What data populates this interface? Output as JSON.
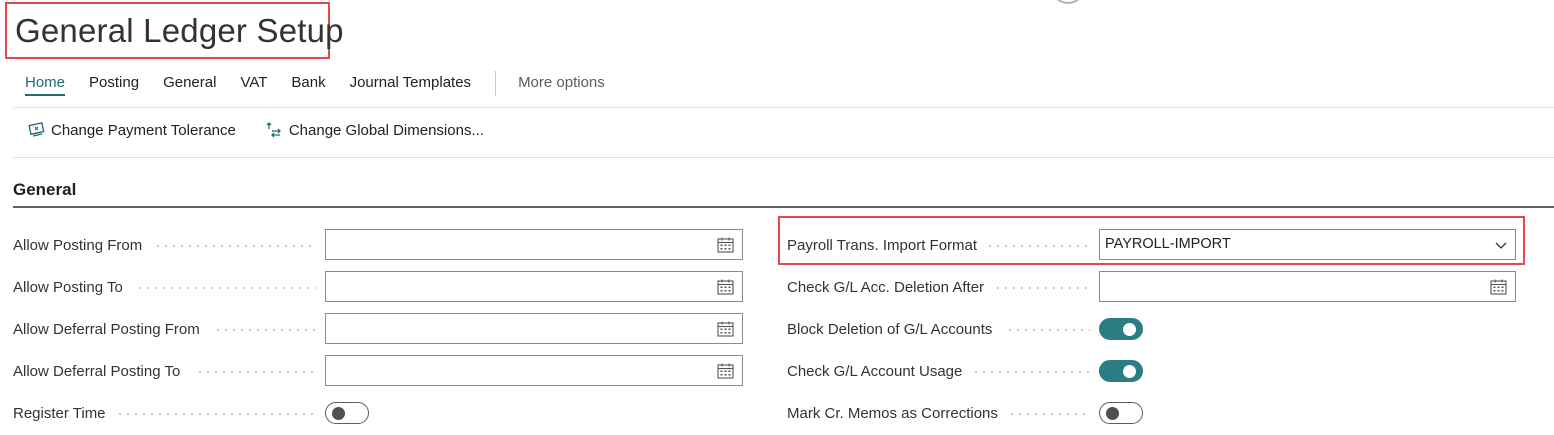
{
  "page": {
    "title": "General Ledger Setup"
  },
  "nav": {
    "tabs": [
      {
        "label": "Home",
        "active": true
      },
      {
        "label": "Posting",
        "active": false
      },
      {
        "label": "General",
        "active": false
      },
      {
        "label": "VAT",
        "active": false
      },
      {
        "label": "Bank",
        "active": false
      },
      {
        "label": "Journal Templates",
        "active": false
      }
    ],
    "more_label": "More options"
  },
  "actions": [
    {
      "label": "Change Payment Tolerance",
      "icon": "payment-tolerance-icon"
    },
    {
      "label": "Change Global Dimensions...",
      "icon": "change-dimensions-icon"
    }
  ],
  "section": {
    "title": "General"
  },
  "left_fields": [
    {
      "label": "Allow Posting From",
      "type": "date",
      "value": ""
    },
    {
      "label": "Allow Posting To",
      "type": "date",
      "value": ""
    },
    {
      "label": "Allow Deferral Posting From",
      "type": "date",
      "value": ""
    },
    {
      "label": "Allow Deferral Posting To",
      "type": "date",
      "value": ""
    },
    {
      "label": "Register Time",
      "type": "toggle",
      "value": false
    }
  ],
  "right_fields": [
    {
      "label": "Payroll Trans. Import Format",
      "type": "select",
      "value": "PAYROLL-IMPORT"
    },
    {
      "label": "Check G/L Acc. Deletion After",
      "type": "date",
      "value": ""
    },
    {
      "label": "Block Deletion of G/L Accounts",
      "type": "toggle",
      "value": true
    },
    {
      "label": "Check G/L Account Usage",
      "type": "toggle",
      "value": true
    },
    {
      "label": "Mark Cr. Memos as Corrections",
      "type": "toggle",
      "value": false
    }
  ],
  "colors": {
    "accent": "#1f6b70",
    "toggle_on": "#2b7d83",
    "highlight": "#e5484d"
  }
}
